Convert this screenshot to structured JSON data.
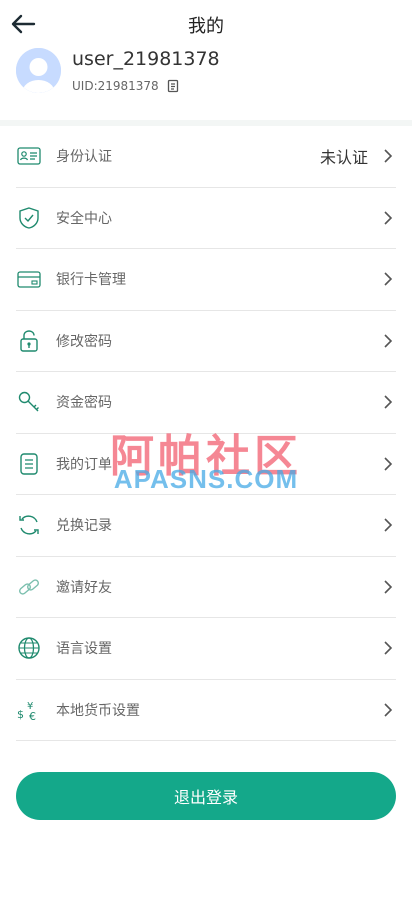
{
  "header": {
    "title": "我的"
  },
  "profile": {
    "username": "user_21981378",
    "uid": "UID:21981378"
  },
  "menu": {
    "items": [
      {
        "icon": "id-card-icon",
        "label": "身份认证",
        "value": "未认证"
      },
      {
        "icon": "shield-check-icon",
        "label": "安全中心",
        "value": ""
      },
      {
        "icon": "bank-card-icon",
        "label": "银行卡管理",
        "value": ""
      },
      {
        "icon": "lock-icon",
        "label": "修改密码",
        "value": ""
      },
      {
        "icon": "key-icon",
        "label": "资金密码",
        "value": ""
      },
      {
        "icon": "order-list-icon",
        "label": "我的订单",
        "value": ""
      },
      {
        "icon": "refresh-icon",
        "label": "兑换记录",
        "value": ""
      },
      {
        "icon": "link-icon",
        "label": "邀请好友",
        "value": ""
      },
      {
        "icon": "globe-icon",
        "label": "语言设置",
        "value": ""
      },
      {
        "icon": "currency-icon",
        "label": "本地货币设置",
        "value": ""
      }
    ]
  },
  "watermark": {
    "cn": "阿帕社区",
    "en": "APASNS.COM"
  },
  "logout_label": "退出登录",
  "colors": {
    "accent": "#14a88a",
    "icon": "#1f8a6e",
    "avatar": "#c7dbff"
  }
}
